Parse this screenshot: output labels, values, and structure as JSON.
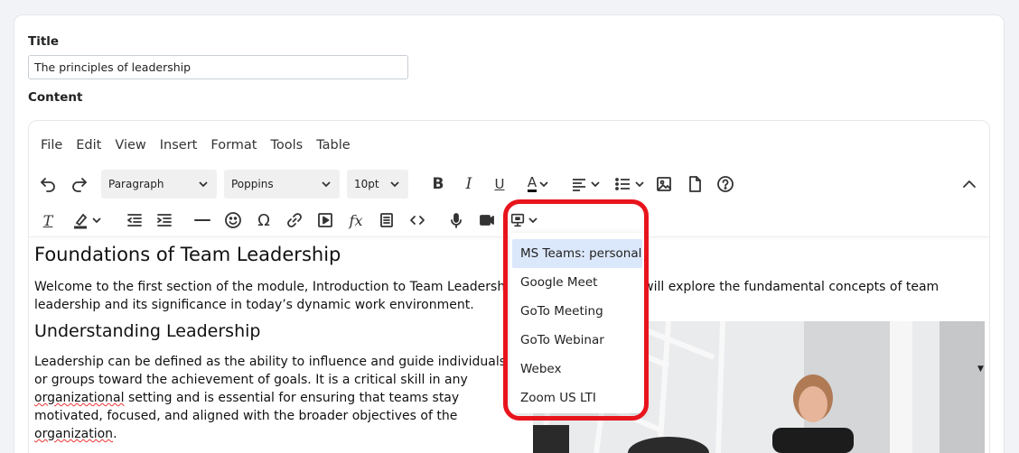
{
  "form": {
    "title_label": "Title",
    "title_value": "The principles of leadership",
    "content_label": "Content"
  },
  "editor": {
    "menu": [
      "File",
      "Edit",
      "View",
      "Insert",
      "Format",
      "Tools",
      "Table"
    ],
    "toolbar": {
      "block_format": "Paragraph",
      "font_family": "Poppins",
      "font_size": "10pt",
      "bold": "B",
      "italic": "I",
      "underline": "U",
      "text_color_glyph": "A",
      "clear_format_glyph": "T",
      "special_char": "Ω",
      "formula": "fx"
    },
    "icons": [
      "undo-icon",
      "redo-icon",
      "bold-icon",
      "italic-icon",
      "underline-icon",
      "text-color-icon",
      "align-icon",
      "bullet-list-icon",
      "image-icon",
      "document-icon",
      "help-icon",
      "collapse-icon",
      "clear-format-icon",
      "highlight-icon",
      "outdent-icon",
      "indent-icon",
      "horizontal-rule-icon",
      "emoji-icon",
      "special-char-icon",
      "link-icon",
      "media-icon",
      "formula-icon",
      "template-icon",
      "code-icon",
      "voice-icon",
      "video-icon",
      "meeting-icon"
    ]
  },
  "document": {
    "heading1": "Foundations of Team Leadership",
    "para1": "Welcome to the first section of the module, Introduction to Team Leadership. In this section, we will explore the fundamental concepts of team leadership and its significance in today’s dynamic work environment.",
    "heading2": "Understanding Leadership",
    "para2_a": "Leadership can be defined as the ability to influence and guide individuals or groups toward the achievement of goals. It is a critical skill in any ",
    "para2_spell1": "organizational",
    "para2_b": " setting and is essential for ensuring that teams stay motivated, focused, and aligned with the broader objectives of the ",
    "para2_spell2": "organization",
    "para2_c": "."
  },
  "meeting_dropdown": {
    "items": [
      "MS Teams: personal",
      "Google Meet",
      "GoTo Meeting",
      "GoTo Webinar",
      "Webex",
      "Zoom US LTI"
    ],
    "selected": "MS Teams: personal"
  },
  "colors": {
    "highlight_border": "#e8141c",
    "selected_item_bg": "#dbe7fb",
    "page_bg": "#f1f3f7"
  }
}
